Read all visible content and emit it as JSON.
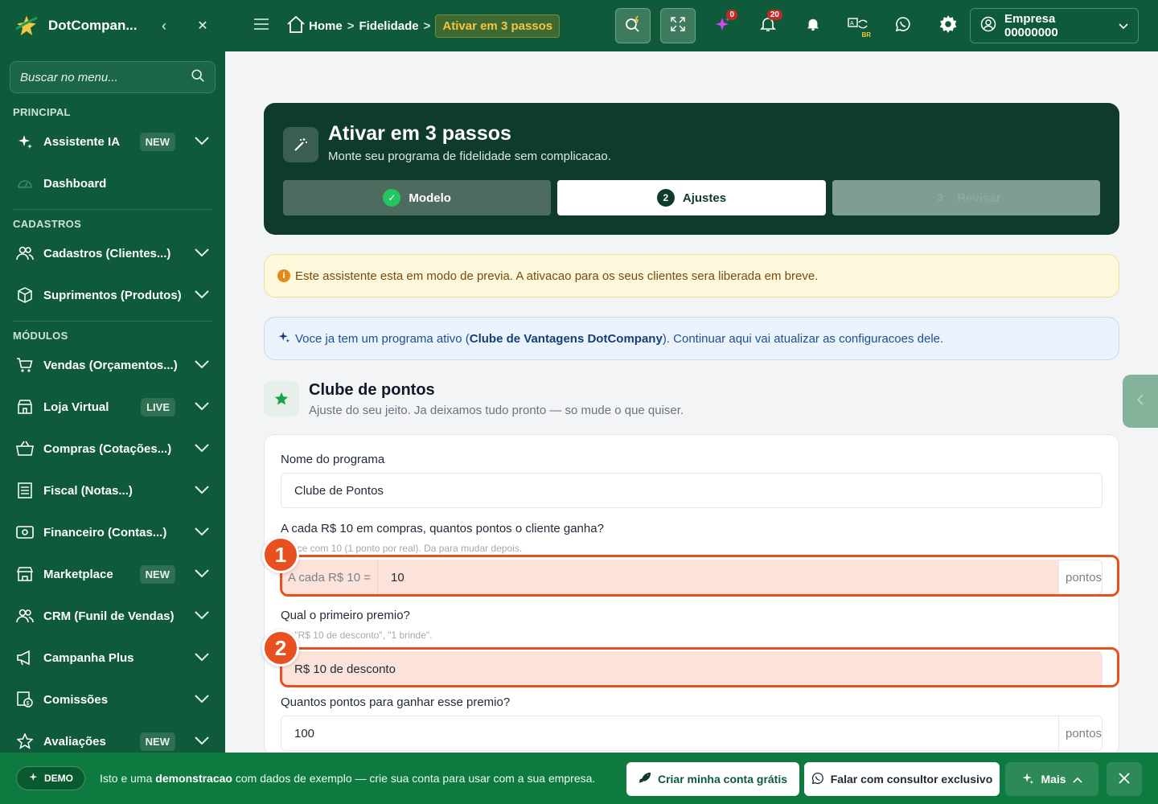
{
  "sidebar": {
    "brand": "DotCompan...",
    "search_placeholder": "Buscar no menu...",
    "sections": {
      "principal": "PRINCIPAL",
      "cadastros": "CADASTROS",
      "modulos": "MÓDULOS"
    },
    "items": [
      {
        "label": "Assistente IA",
        "badge": "NEW",
        "icon": "sparkles-icon"
      },
      {
        "label": "Dashboard",
        "badge": "",
        "icon": "gauge-icon"
      },
      {
        "label": "Cadastros (Clientes...)",
        "badge": "",
        "icon": "users-icon"
      },
      {
        "label": "Suprimentos (Produtos)",
        "badge": "",
        "icon": "box-icon"
      },
      {
        "label": "Vendas (Orçamentos...)",
        "badge": "",
        "icon": "cart-icon"
      },
      {
        "label": "Loja Virtual",
        "badge": "LIVE",
        "icon": "store-icon"
      },
      {
        "label": "Compras (Cotações...)",
        "badge": "",
        "icon": "basket-icon"
      },
      {
        "label": "Fiscal (Notas...)",
        "badge": "",
        "icon": "document-icon"
      },
      {
        "label": "Financeiro (Contas...)",
        "badge": "",
        "icon": "money-icon"
      },
      {
        "label": "Marketplace",
        "badge": "NEW",
        "icon": "storefront-icon"
      },
      {
        "label": "CRM (Funil de Vendas)",
        "badge": "",
        "icon": "users-icon"
      },
      {
        "label": "Campanha Plus",
        "badge": "",
        "icon": "megaphone-icon"
      },
      {
        "label": "Comissões",
        "badge": "",
        "icon": "commission-icon"
      },
      {
        "label": "Avaliações",
        "badge": "NEW",
        "icon": "star-icon"
      }
    ]
  },
  "topbar": {
    "breadcrumb": {
      "home": "Home",
      "section": "Fidelidade",
      "current": "Ativar em 3 passos"
    },
    "notifications_ai": "0",
    "notifications_bell": "20",
    "lang_badge": "BR",
    "company": "Empresa 00000000"
  },
  "hero": {
    "title": "Ativar em 3 passos",
    "subtitle": "Monte seu programa de fidelidade sem complicacao.",
    "steps": [
      {
        "num": "✓",
        "label": "Modelo",
        "state": "done"
      },
      {
        "num": "2",
        "label": "Ajustes",
        "state": "active"
      },
      {
        "num": "3",
        "label": "Revisar",
        "state": "pending"
      }
    ]
  },
  "alerts": {
    "warning": "Este assistente esta em modo de previa. A ativacao para os seus clientes sera liberada em breve.",
    "info_prefix": "Voce ja tem um programa ativo (",
    "info_program": "Clube de Vantagens DotCompany",
    "info_suffix": "). Continuar aqui vai atualizar as configuracoes dele."
  },
  "section": {
    "title": "Clube de pontos",
    "subtitle": "Ajuste do seu jeito. Ja deixamos tudo pronto — so mude o que quiser."
  },
  "form": {
    "program_name_label": "Nome do programa",
    "program_name_value": "Clube de Pontos",
    "points_label": "A cada R$ 10 em compras, quantos pontos o cliente ganha?",
    "points_hint": "...ece com 10 (1 ponto por real). Da para mudar depois.",
    "points_prefix": "A cada R$ 10 =",
    "points_value": "10",
    "points_suffix": "pontos",
    "prize_label": "Qual o primeiro premio?",
    "prize_hint": "... \"R$ 10 de desconto\", \"1 brinde\".",
    "prize_value": "R$ 10 de desconto",
    "prize_points_label": "Quantos pontos para ganhar esse premio?",
    "prize_points_value": "100",
    "prize_points_suffix": "pontos"
  },
  "markers": [
    "1",
    "2"
  ],
  "footer": {
    "demo_badge": "DEMO",
    "text_prefix": "Isto e uma ",
    "text_bold": "demonstracao",
    "text_suffix": " com dados de exemplo — crie sua conta para usar com a sua empresa.",
    "cta_create": "Criar minha conta grátis",
    "cta_consultant": "Falar com consultor exclusivo",
    "more": "Mais"
  }
}
